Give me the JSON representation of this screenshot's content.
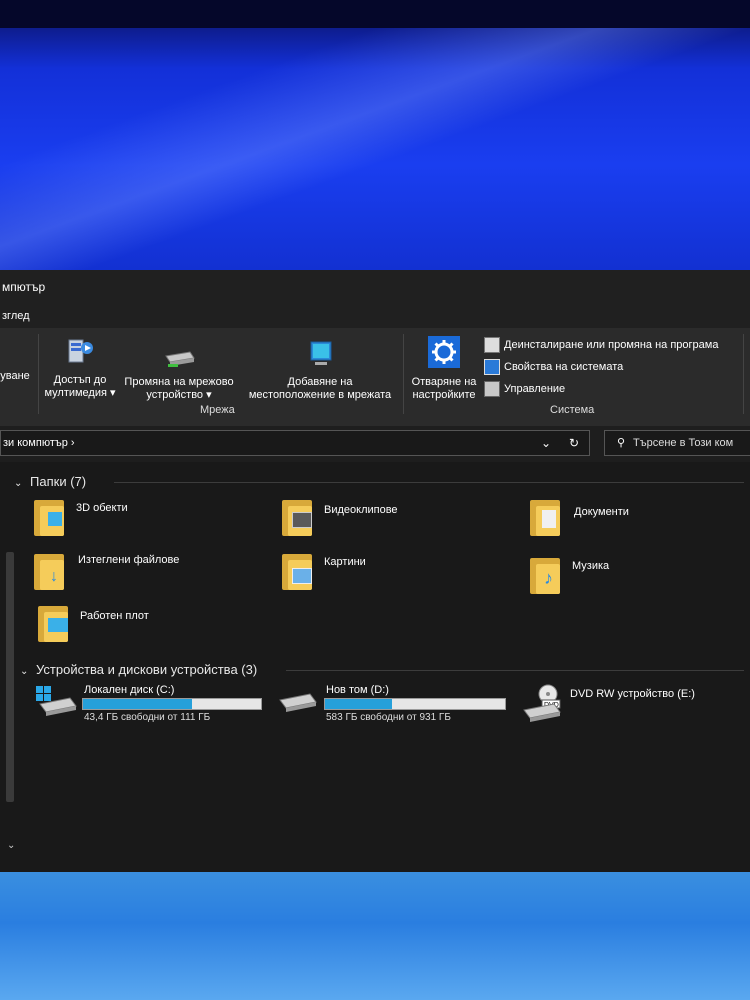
{
  "window": {
    "title": "мпютър"
  },
  "menu": {
    "view_tab": "зглед"
  },
  "ribbon": {
    "partial_label": "уване",
    "media_access": {
      "line1": "Достъп до",
      "line2": "мултимедия ▾"
    },
    "map_drive": {
      "line1": "Промяна на мрежово",
      "line2": "устройство ▾"
    },
    "add_location": {
      "line1": "Добавяне на",
      "line2": "местоположение в мрежата"
    },
    "group_network": "Мрежа",
    "open_settings": {
      "line1": "Отваряне на",
      "line2": "настройките"
    },
    "uninstall": "Деинсталиране или промяна на програма",
    "system_properties": "Свойства на системата",
    "manage": "Управление",
    "group_system": "Система"
  },
  "address": {
    "path": "зи компютър  ›",
    "search_placeholder": "Търсене в Този ком"
  },
  "folders": {
    "header": "Папки (7)",
    "items": [
      "3D обекти",
      "Видеоклипове",
      "Документи",
      "Изтеглени файлове",
      "Картини",
      "Музика",
      "Работен плот"
    ]
  },
  "devices": {
    "header": "Устройства и дискови устройства (3)",
    "drives": [
      {
        "name": "Локален диск (C:)",
        "free": "43,4 ГБ свободни от 111 ГБ",
        "used_fraction": 0.61
      },
      {
        "name": "Нов том (D:)",
        "free": "583 ГБ свободни от 931 ГБ",
        "used_fraction": 0.37
      },
      {
        "name": "DVD RW устройство (E:)"
      }
    ]
  }
}
